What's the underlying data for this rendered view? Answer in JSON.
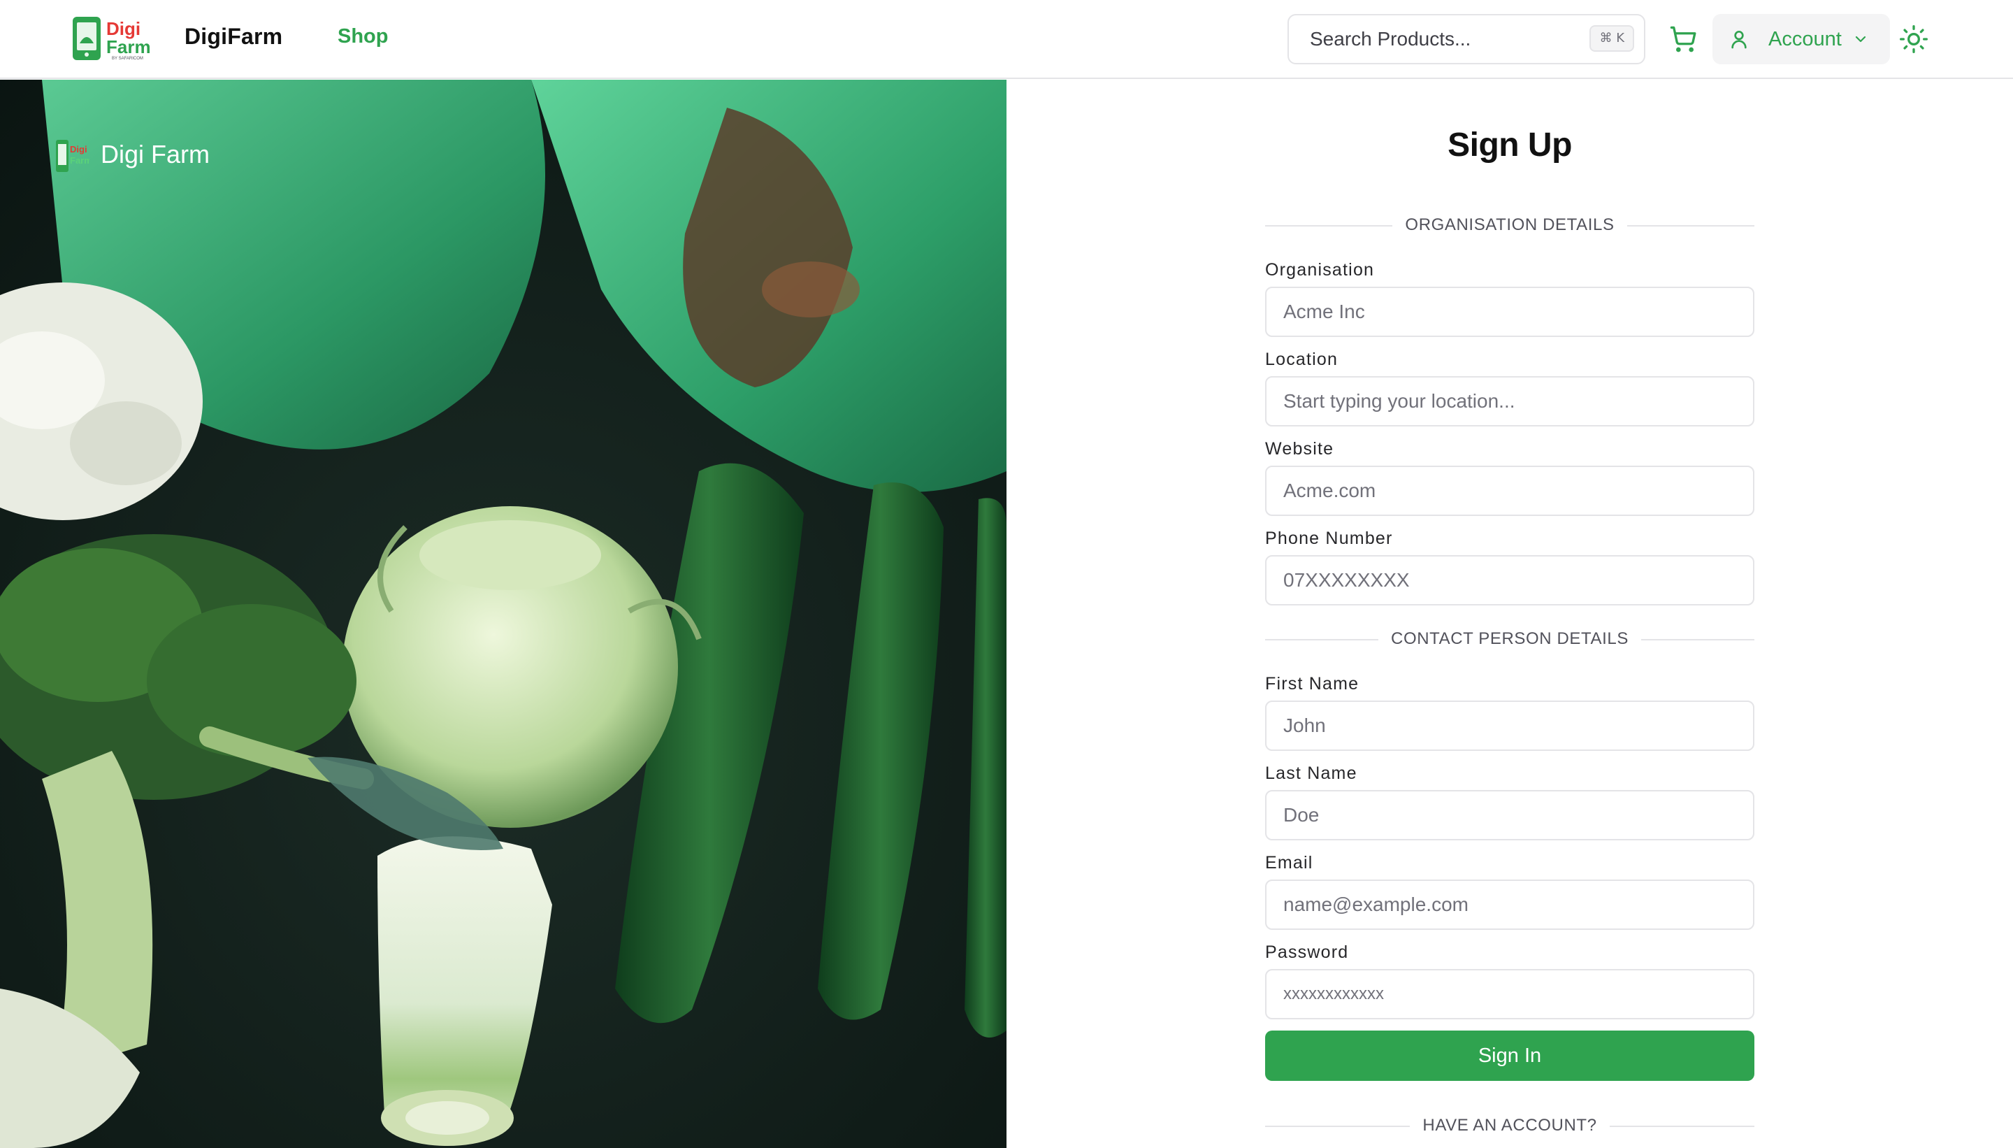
{
  "header": {
    "brand_logo_text": "Digi Farm",
    "brand_logo_tagline": "BY SAFARICOM",
    "brand_name": "DigiFarm",
    "nav_shop": "Shop",
    "search_placeholder": "Search Products...",
    "search_shortcut": "⌘ K",
    "account_label": "Account",
    "icons": [
      "cart-icon",
      "user-icon",
      "chevron-down-icon",
      "sun-icon"
    ]
  },
  "hero": {
    "logo_text": "Digi Farm",
    "title": "Digi Farm"
  },
  "form": {
    "title": "Sign Up",
    "section_org": "ORGANISATION DETAILS",
    "section_contact": "CONTACT PERSON DETAILS",
    "section_account": "HAVE AN ACCOUNT?",
    "fields": {
      "organisation": {
        "label": "Organisation",
        "placeholder": "Acme Inc"
      },
      "location": {
        "label": "Location",
        "placeholder": "Start typing your location..."
      },
      "website": {
        "label": "Website",
        "placeholder": "Acme.com"
      },
      "phone": {
        "label": "Phone Number",
        "placeholder": "07XXXXXXXX"
      },
      "first_name": {
        "label": "First Name",
        "placeholder": "John"
      },
      "last_name": {
        "label": "Last Name",
        "placeholder": "Doe"
      },
      "email": {
        "label": "Email",
        "placeholder": "name@example.com"
      },
      "password": {
        "label": "Password",
        "placeholder": "xxxxxxxxxxxx"
      }
    },
    "submit_label": "Sign In"
  },
  "colors": {
    "accent": "#2fa34f",
    "border": "#e4e4e7",
    "muted_text": "#71717a"
  }
}
